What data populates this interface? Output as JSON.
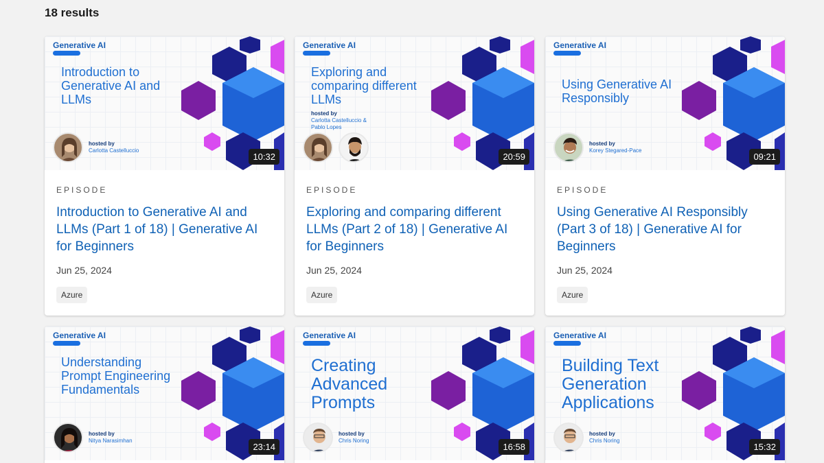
{
  "results_count": "18 results",
  "cards": [
    {
      "series_tag": "Generative AI",
      "thumb_title": [
        "Introduction to",
        "Generative AI and",
        "LLMs"
      ],
      "hosted_label": "hosted by",
      "hosts": "Carlotta Castelluccio",
      "duration": "10:32",
      "episode_label": "EPISODE",
      "title": "Introduction to Generative AI and LLMs (Part 1 of 18) | Generative AI for Beginners",
      "date": "Jun 25, 2024",
      "badge": "Azure"
    },
    {
      "series_tag": "Generative AI",
      "thumb_title": [
        "Exploring and",
        "comparing different",
        "LLMs"
      ],
      "hosted_label": "hosted by",
      "hosts": "Carlotta Castelluccio &",
      "hosts2": "Pablo Lopes",
      "duration": "20:59",
      "episode_label": "EPISODE",
      "title": "Exploring and comparing different LLMs (Part 2 of 18) | Generative AI for Beginners",
      "date": "Jun 25, 2024",
      "badge": "Azure"
    },
    {
      "series_tag": "Generative AI",
      "thumb_title": [
        "Using Generative AI",
        "Responsibly"
      ],
      "hosted_label": "hosted by",
      "hosts": "Korey Stegared-Pace",
      "duration": "09:21",
      "episode_label": "EPISODE",
      "title": "Using Generative AI Responsibly (Part 3 of 18) | Generative AI for Beginners",
      "date": "Jun 25, 2024",
      "badge": "Azure"
    },
    {
      "series_tag": "Generative AI",
      "thumb_title": [
        "Understanding",
        "Prompt Engineering",
        "Fundamentals"
      ],
      "hosted_label": "hosted by",
      "hosts": "Nitya Narasimhan",
      "duration": "23:14"
    },
    {
      "series_tag": "Generative AI",
      "thumb_title": [
        "Creating",
        "Advanced",
        "Prompts"
      ],
      "hosted_label": "hosted by",
      "hosts": "Chris Noring",
      "duration": "16:58"
    },
    {
      "series_tag": "Generative AI",
      "thumb_title": [
        "Building Text",
        "Generation",
        "Applications"
      ],
      "hosted_label": "hosted by",
      "hosts": "Chris Noring",
      "duration": "15:32"
    }
  ],
  "colors": {
    "accent": "#0f61b5",
    "hex_blue": "#1e63d6",
    "hex_purple": "#7a1fa2",
    "hex_magenta": "#d94bf0",
    "hex_navy": "#1a1f8a"
  }
}
